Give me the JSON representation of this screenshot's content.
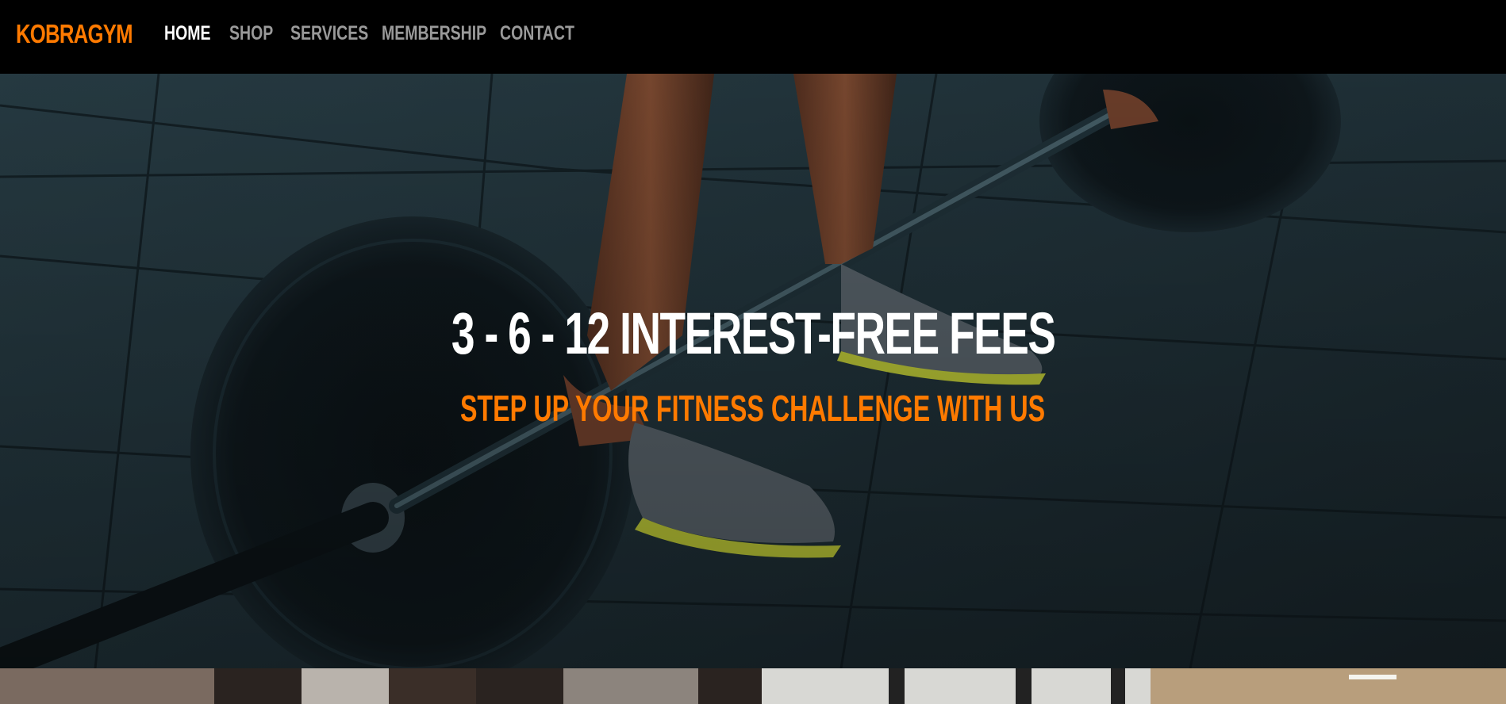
{
  "brand": {
    "name": "KOBRAGYM"
  },
  "nav": {
    "items": [
      {
        "label": "HOME",
        "active": true
      },
      {
        "label": "SHOP",
        "active": false
      },
      {
        "label": "SERVICES",
        "active": false
      },
      {
        "label": "MEMBERSHIP",
        "active": false
      },
      {
        "label": "CONTACT",
        "active": false
      }
    ]
  },
  "hero": {
    "title": "3 - 6 - 12 INTEREST-FREE FEES",
    "subtitle": "STEP UP YOUR FITNESS CHALLENGE WITH US",
    "image": "barbell-deadlift-photo"
  },
  "colors": {
    "accent": "#ff7a00",
    "nav_bg": "#000000",
    "nav_text": "#9a9a9a",
    "nav_active": "#ffffff"
  }
}
